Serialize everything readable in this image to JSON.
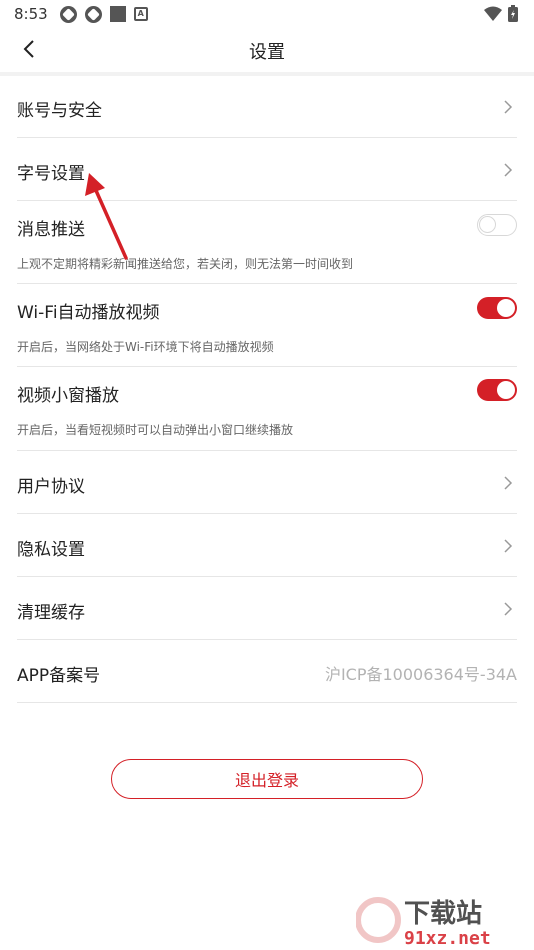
{
  "status_bar": {
    "time": "8:53"
  },
  "header": {
    "title": "设置"
  },
  "settings": {
    "account": {
      "label": "账号与安全"
    },
    "font_size": {
      "label": "字号设置"
    },
    "push": {
      "label": "消息推送",
      "desc": "上观不定期将精彩新闻推送给您，若关闭，则无法第一时间收到",
      "enabled": false
    },
    "wifi_autoplay": {
      "label": "Wi-Fi自动播放视频",
      "desc": "开启后，当网络处于Wi-Fi环境下将自动播放视频",
      "enabled": true
    },
    "mini_window": {
      "label": "视频小窗播放",
      "desc": "开启后，当看短视频时可以自动弹出小窗口继续播放",
      "enabled": true
    },
    "user_agreement": {
      "label": "用户协议"
    },
    "privacy": {
      "label": "隐私设置"
    },
    "clear_cache": {
      "label": "清理缓存"
    },
    "app_record": {
      "label": "APP备案号",
      "value": "沪ICP备10006364号-34A"
    }
  },
  "logout": {
    "label": "退出登录"
  },
  "colors": {
    "accent": "#d42027",
    "divider": "#e6e6e6",
    "muted": "#b3b3b3"
  },
  "watermark": {
    "text": "下载站",
    "domain": "91xz.net"
  }
}
